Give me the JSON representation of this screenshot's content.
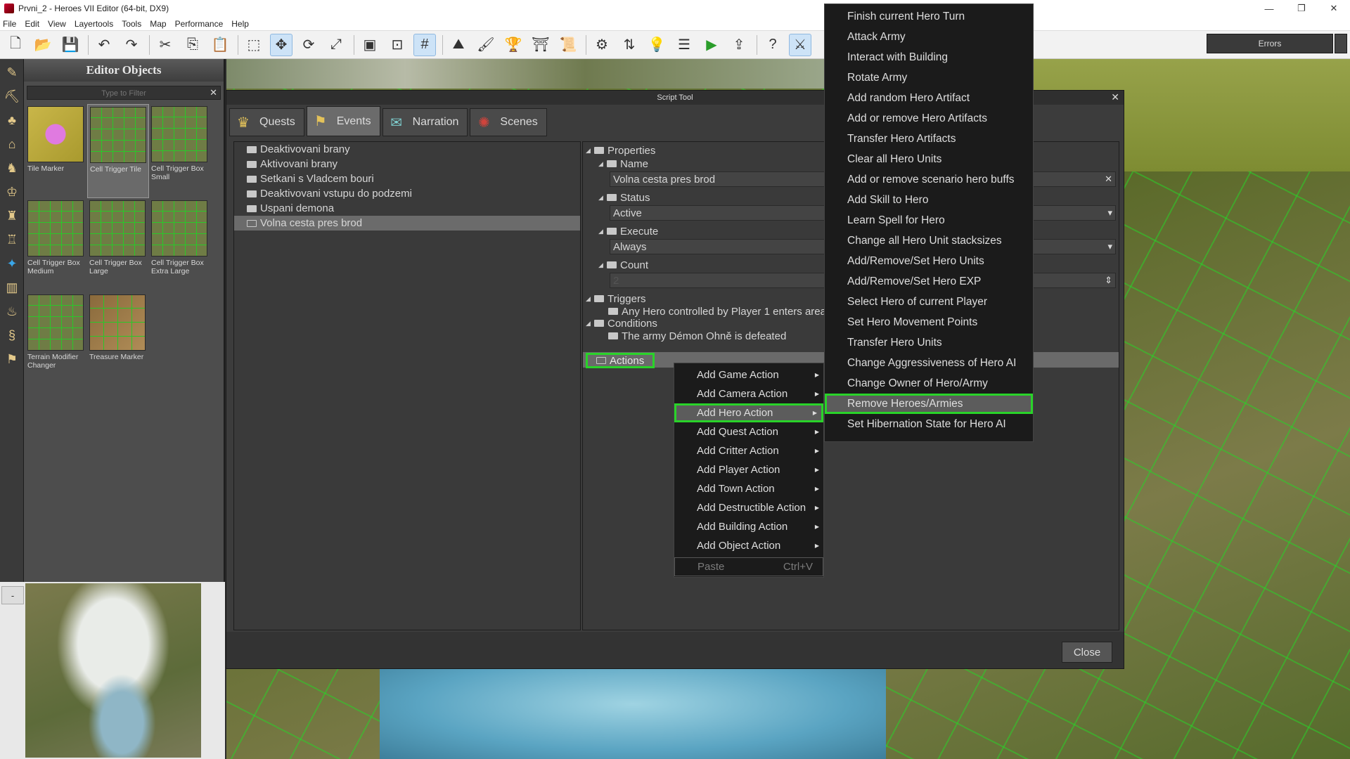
{
  "window": {
    "title": "Prvni_2 - Heroes VII Editor (64-bit, DX9)",
    "controls": [
      "—",
      "❐",
      "✕"
    ]
  },
  "menubar": [
    "File",
    "Edit",
    "View",
    "Layertools",
    "Tools",
    "Map",
    "Performance",
    "Help"
  ],
  "toolbar": {
    "icons": [
      "new-file-icon",
      "open-folder-icon",
      "save-icon",
      "undo-icon",
      "redo-icon",
      "cut-icon",
      "copy-icon",
      "paste-icon",
      "select-icon",
      "move-icon",
      "rotate-icon",
      "scale-icon",
      "screenshot-icon",
      "2d-view-icon",
      "grid-icon",
      "terrain-icon",
      "paint-icon",
      "trophy-icon",
      "gate-icon",
      "scroll-icon",
      "gear-icon",
      "swap-icon",
      "lightbulb-icon",
      "script-icon",
      "play-icon",
      "export-icon",
      "help-icon",
      "fight-icon"
    ],
    "errors_label": "Errors"
  },
  "editor_objects": {
    "title": "Editor Objects",
    "filter_placeholder": "Type to Filter",
    "items": [
      {
        "label": "Tile Marker",
        "thumb": "yellow"
      },
      {
        "label": "Cell Trigger Tile",
        "thumb": "grid",
        "selected": true
      },
      {
        "label": "Cell Trigger Box Small",
        "thumb": "grid"
      },
      {
        "label": "Cell Trigger Box Medium",
        "thumb": "grid"
      },
      {
        "label": "Cell Trigger Box Large",
        "thumb": "grid"
      },
      {
        "label": "Cell Trigger Box Extra Large",
        "thumb": "grid"
      },
      {
        "label": "Terrain Modifier Changer",
        "thumb": "grid"
      },
      {
        "label": "Treasure Marker",
        "thumb": "treasure"
      }
    ]
  },
  "minimap": {
    "toggle_label": "-"
  },
  "script_tool": {
    "title": "Script Tool",
    "tabs": [
      {
        "label": "Quests",
        "icon": "trophy-icon"
      },
      {
        "label": "Events",
        "icon": "flag-icon",
        "active": true
      },
      {
        "label": "Narration",
        "icon": "speech-icon"
      },
      {
        "label": "Scenes",
        "icon": "film-icon"
      }
    ],
    "events": [
      "Deaktivovani brany",
      "Aktivovani brany",
      "Setkani s Vladcem bouri",
      "Deaktivovani vstupu do podzemi",
      "Uspani demona",
      "Volna cesta pres brod"
    ],
    "selected_event": 5,
    "properties": {
      "root": "Properties",
      "name_label": "Name",
      "name_value": "Volna cesta pres brod",
      "status_label": "Status",
      "status_value": "Active",
      "execute_label": "Execute",
      "execute_value": "Always",
      "count_label": "Count",
      "count_value": "2",
      "triggers_label": "Triggers",
      "trigger_item": "Any Hero controlled by Player 1 enters area Cell Trigger Tile",
      "conditions_label": "Conditions",
      "condition_item": "The army Démon Ohně is defeated",
      "actions_label": "Actions"
    },
    "close_label": "Close"
  },
  "context_menu": {
    "items": [
      {
        "label": "Add Game Action",
        "submenu": true
      },
      {
        "label": "Add Camera Action",
        "submenu": true
      },
      {
        "label": "Add Hero Action",
        "submenu": true,
        "highlighted": true
      },
      {
        "label": "Add Quest Action",
        "submenu": true
      },
      {
        "label": "Add Critter Action",
        "submenu": true
      },
      {
        "label": "Add Player Action",
        "submenu": true
      },
      {
        "label": "Add Town Action",
        "submenu": true
      },
      {
        "label": "Add Destructible Action",
        "submenu": true
      },
      {
        "label": "Add Building Action",
        "submenu": true
      },
      {
        "label": "Add Object Action",
        "submenu": true
      }
    ],
    "paste": {
      "label": "Paste",
      "shortcut": "Ctrl+V"
    }
  },
  "hero_submenu": {
    "items": [
      "Finish current Hero Turn",
      "Attack Army",
      "Interact with Building",
      "Rotate Army",
      "Add random Hero Artifact",
      "Add or remove Hero Artifacts",
      "Transfer Hero Artifacts",
      "Clear all Hero Units",
      "Add or remove scenario hero buffs",
      "Add Skill to Hero",
      "Learn Spell for Hero",
      "Change all Hero Unit stacksizes",
      "Add/Remove/Set Hero Units",
      "Add/Remove/Set Hero EXP",
      "Select Hero of current Player",
      "Set Hero Movement Points",
      "Transfer Hero Units",
      "Change Aggressiveness of Hero AI",
      "Change Owner of Hero/Army",
      "Remove Heroes/Armies",
      "Set Hibernation State for Hero AI"
    ],
    "highlighted_index": 19
  }
}
